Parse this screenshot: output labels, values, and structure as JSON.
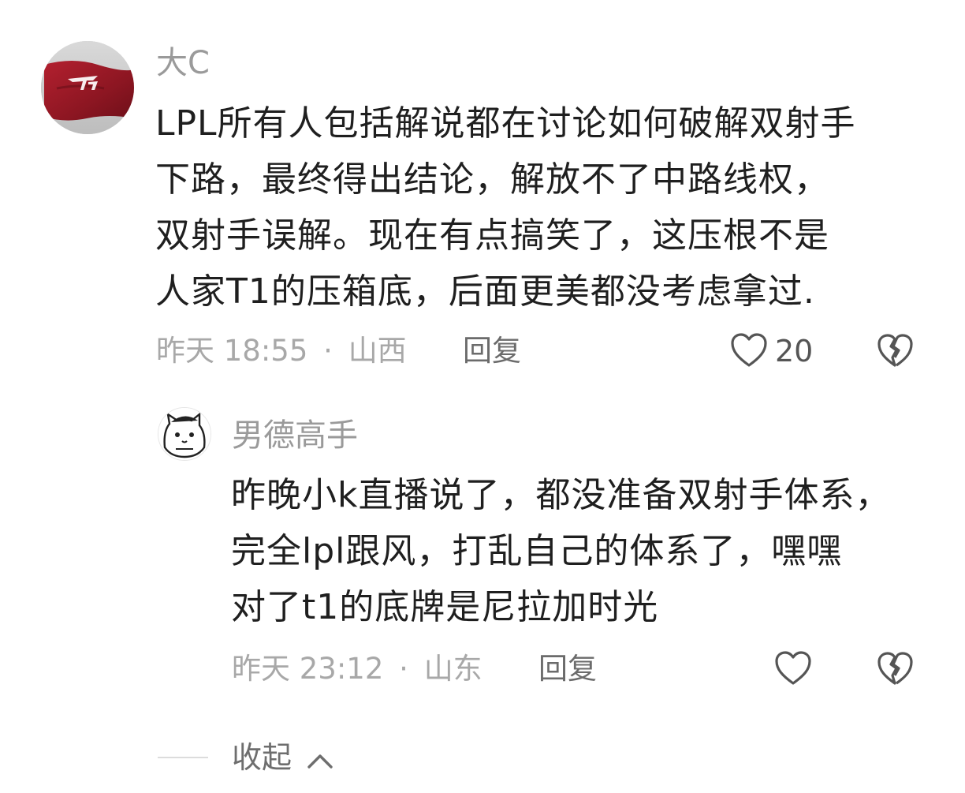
{
  "comment": {
    "username": "大C",
    "lines": [
      "LPL所有人包括解说都在讨论如何破解双射手",
      "下路，最终得出结论，解放不了中路线权，",
      "双射手误解。现在有点搞笑了，这压根不是",
      "人家T1的压箱底，后面更美都没考虑拿过."
    ],
    "time": "昨天 18:55",
    "dot": "·",
    "location": "山西",
    "reply_label": "回复",
    "like_count": "20"
  },
  "reply": {
    "username": "男德高手",
    "lines": [
      "昨晚小k直播说了，都没准备双射手体系，",
      "完全lpl跟风，打乱自己的体系了，嘿嘿",
      "对了t1的底牌是尼拉加时光"
    ],
    "time": "昨天 23:12",
    "dot": "·",
    "location": "山东",
    "reply_label": "回复"
  },
  "collapse_label": "收起",
  "icons": {
    "like": "heart-outline-icon",
    "dislike": "broken-heart-icon",
    "collapse": "chevron-up-icon"
  },
  "colors": {
    "avatar_flag": "#9e1d2a",
    "text_primary": "#1f1f1f",
    "text_secondary": "#a8a8a8"
  }
}
